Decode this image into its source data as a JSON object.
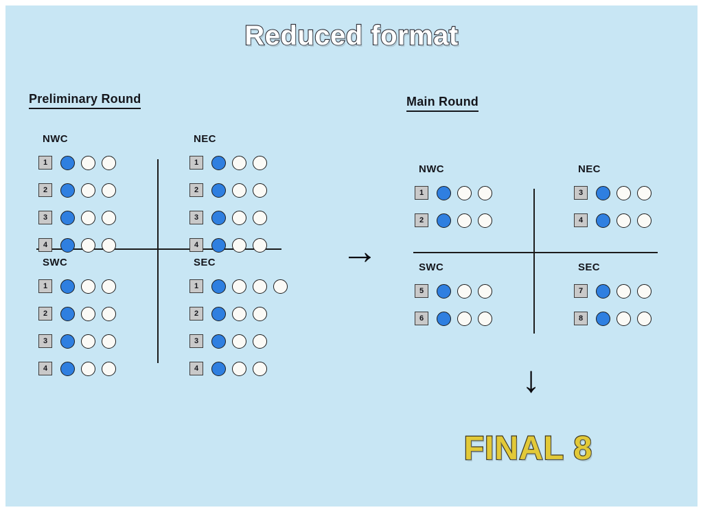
{
  "title": "Reduced format",
  "colors": {
    "background": "#c8e6f4",
    "qualified_dot": "#2f7fe0",
    "empty_dot": "#fbfaf6",
    "seed_box": "#c9c9c9",
    "line": "#1b1b1b",
    "final_text": "#e2c938"
  },
  "preliminary": {
    "heading": "Preliminary Round",
    "groups": [
      {
        "name": "NWC",
        "rows": [
          {
            "seed": "1",
            "dots": [
              "filled",
              "empty",
              "empty"
            ]
          },
          {
            "seed": "2",
            "dots": [
              "filled",
              "empty",
              "empty"
            ]
          },
          {
            "seed": "3",
            "dots": [
              "filled",
              "empty",
              "empty"
            ]
          },
          {
            "seed": "4",
            "dots": [
              "filled",
              "empty",
              "empty"
            ]
          }
        ]
      },
      {
        "name": "NEC",
        "rows": [
          {
            "seed": "1",
            "dots": [
              "filled",
              "empty",
              "empty"
            ]
          },
          {
            "seed": "2",
            "dots": [
              "filled",
              "empty",
              "empty"
            ]
          },
          {
            "seed": "3",
            "dots": [
              "filled",
              "empty",
              "empty"
            ]
          },
          {
            "seed": "4",
            "dots": [
              "filled",
              "empty",
              "empty"
            ]
          }
        ]
      },
      {
        "name": "SWC",
        "rows": [
          {
            "seed": "1",
            "dots": [
              "filled",
              "empty",
              "empty"
            ]
          },
          {
            "seed": "2",
            "dots": [
              "filled",
              "empty",
              "empty"
            ]
          },
          {
            "seed": "3",
            "dots": [
              "filled",
              "empty",
              "empty"
            ]
          },
          {
            "seed": "4",
            "dots": [
              "filled",
              "empty",
              "empty"
            ]
          }
        ]
      },
      {
        "name": "SEC",
        "rows": [
          {
            "seed": "1",
            "dots": [
              "filled",
              "empty",
              "empty",
              "empty"
            ]
          },
          {
            "seed": "2",
            "dots": [
              "filled",
              "empty",
              "empty"
            ]
          },
          {
            "seed": "3",
            "dots": [
              "filled",
              "empty",
              "empty"
            ]
          },
          {
            "seed": "4",
            "dots": [
              "filled",
              "empty",
              "empty"
            ]
          }
        ]
      }
    ]
  },
  "main": {
    "heading": "Main Round",
    "groups": [
      {
        "name": "NWC",
        "rows": [
          {
            "seed": "1",
            "dots": [
              "filled",
              "empty",
              "empty"
            ]
          },
          {
            "seed": "2",
            "dots": [
              "filled",
              "empty",
              "empty"
            ]
          }
        ]
      },
      {
        "name": "NEC",
        "rows": [
          {
            "seed": "3",
            "dots": [
              "filled",
              "empty",
              "empty"
            ]
          },
          {
            "seed": "4",
            "dots": [
              "filled",
              "empty",
              "empty"
            ]
          }
        ]
      },
      {
        "name": "SWC",
        "rows": [
          {
            "seed": "5",
            "dots": [
              "filled",
              "empty",
              "empty"
            ]
          },
          {
            "seed": "6",
            "dots": [
              "filled",
              "empty",
              "empty"
            ]
          }
        ]
      },
      {
        "name": "SEC",
        "rows": [
          {
            "seed": "7",
            "dots": [
              "filled",
              "empty",
              "empty"
            ]
          },
          {
            "seed": "8",
            "dots": [
              "filled",
              "empty",
              "empty"
            ]
          }
        ]
      }
    ]
  },
  "arrows": {
    "prelim_to_main": "→",
    "main_to_final": "↓"
  },
  "final": {
    "label": "FINAL 8"
  }
}
